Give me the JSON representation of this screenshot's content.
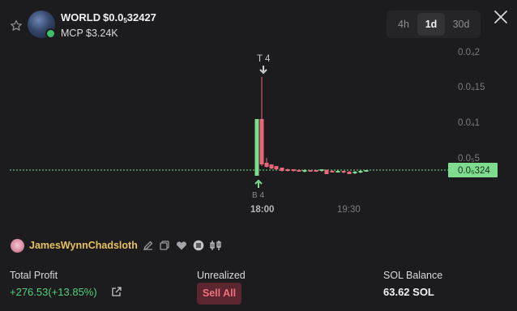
{
  "header": {
    "token_name": "WORLD",
    "price_prefix": "$0.0",
    "price_sub": "5",
    "price_rest": "32427",
    "mcp": "MCP $3.24K",
    "star_icon": "star-icon",
    "close_icon": "close-icon"
  },
  "timeframes": [
    {
      "label": "4h",
      "active": false
    },
    {
      "label": "1d",
      "active": true
    },
    {
      "label": "30d",
      "active": false
    }
  ],
  "chart_data": {
    "type": "candlestick",
    "y_tick_labels": [
      "0.0₄2",
      "0.0₄15",
      "0.0₄1",
      "0.0₅5"
    ],
    "current_price_label": "0.0₅324",
    "x_tick_labels": [
      "18:00",
      "19:30"
    ],
    "markers": {
      "top_marker": "T 4",
      "bottom_marker": "B 4"
    },
    "colors": {
      "up": "#7fdc8e",
      "down": "#e8687a",
      "price_line": "#7fdc8e"
    }
  },
  "user": {
    "name": "JamesWynnChadsloth",
    "icons": [
      "edit-icon",
      "copy-icon",
      "heart-icon",
      "list-icon",
      "candles-icon"
    ]
  },
  "stats": {
    "total_profit_label": "Total Profit",
    "total_profit_value": "+276.53(+13.85%)",
    "unrealized_label": "Unrealized",
    "sell_all_label": "Sell All",
    "sol_balance_label": "SOL Balance",
    "sol_balance_value": "63.62 SOL"
  }
}
